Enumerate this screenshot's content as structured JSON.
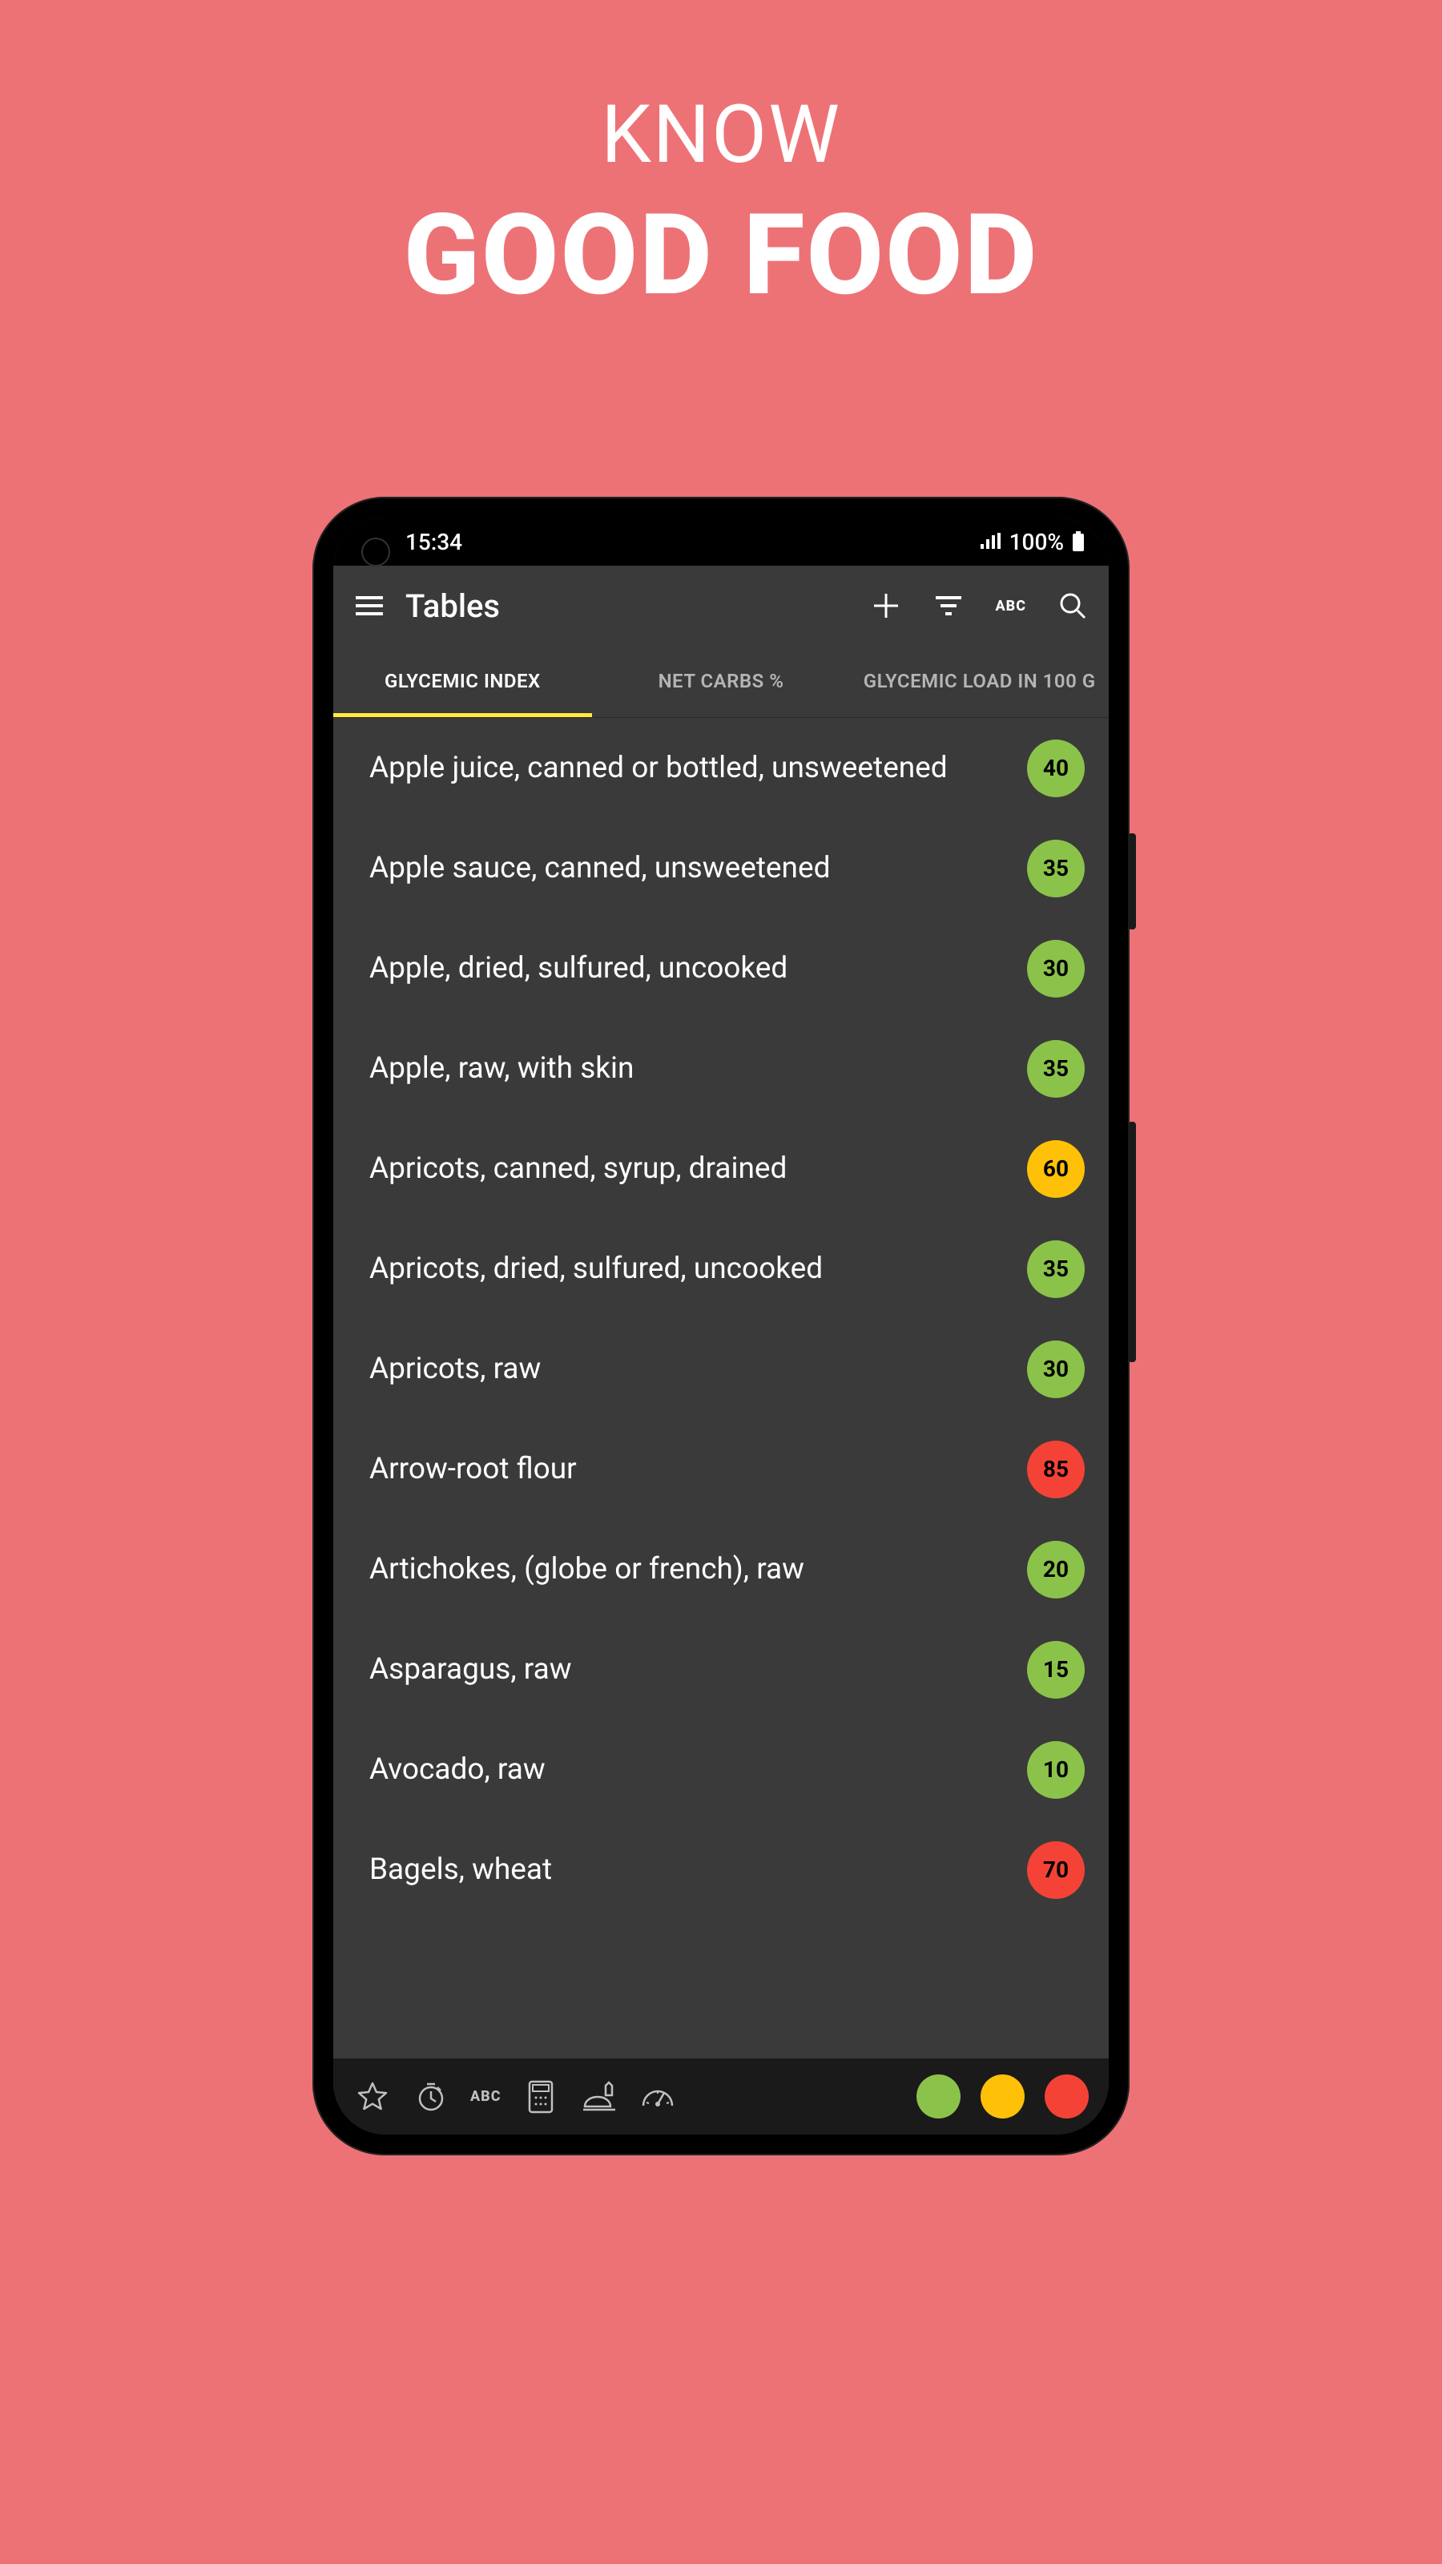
{
  "promo": {
    "line1": "KNOW",
    "line2": "GOOD FOOD"
  },
  "status": {
    "time": "15:34",
    "battery_text": "100%"
  },
  "header": {
    "title": "Tables",
    "abc_label": "ABC"
  },
  "tabs": {
    "items": [
      {
        "label": "GLYCEMIC INDEX",
        "active": true
      },
      {
        "label": "NET CARBS %",
        "active": false
      },
      {
        "label": "GLYCEMIC LOAD IN 100 G",
        "active": false
      }
    ]
  },
  "list": {
    "items": [
      {
        "name": "Apple juice, canned or bottled, unsweetened",
        "value": "40",
        "tier": "green"
      },
      {
        "name": "Apple sauce, canned, unsweetened",
        "value": "35",
        "tier": "green"
      },
      {
        "name": "Apple, dried, sulfured, uncooked",
        "value": "30",
        "tier": "green"
      },
      {
        "name": "Apple, raw, with skin",
        "value": "35",
        "tier": "green"
      },
      {
        "name": "Apricots, canned, syrup, drained",
        "value": "60",
        "tier": "yellow"
      },
      {
        "name": "Apricots, dried, sulfured, uncooked",
        "value": "35",
        "tier": "green"
      },
      {
        "name": "Apricots, raw",
        "value": "30",
        "tier": "green"
      },
      {
        "name": "Arrow-root flour",
        "value": "85",
        "tier": "red"
      },
      {
        "name": "Artichokes, (globe or french), raw",
        "value": "20",
        "tier": "green"
      },
      {
        "name": "Asparagus, raw",
        "value": "15",
        "tier": "green"
      },
      {
        "name": "Avocado, raw",
        "value": "10",
        "tier": "green"
      },
      {
        "name": "Bagels, wheat",
        "value": "70",
        "tier": "red"
      }
    ]
  },
  "bottom": {
    "abc_label": "ABC"
  },
  "colors": {
    "green": "#8bc34a",
    "yellow": "#ffc107",
    "red": "#f44336"
  }
}
